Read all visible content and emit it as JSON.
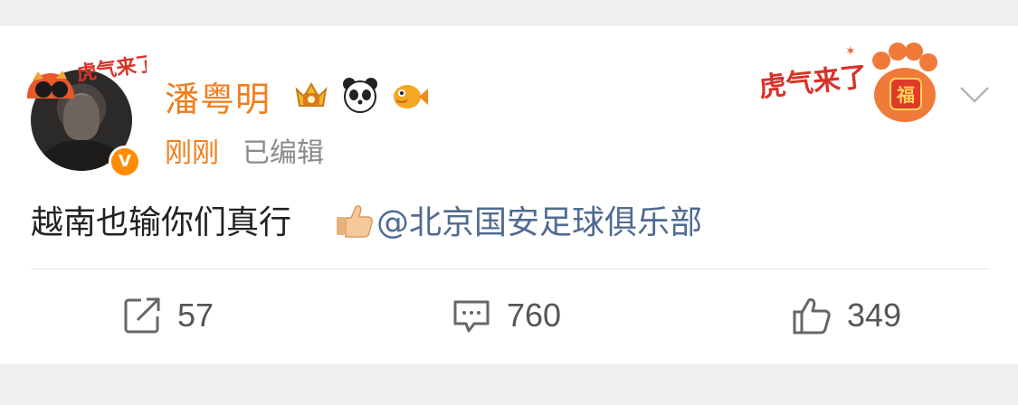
{
  "post": {
    "user": {
      "name": "潘粤明",
      "verified_mark": "V",
      "avatar_frame_text": "虎气来了",
      "badges": [
        "crown-badge",
        "panda-badge",
        "fish-badge"
      ]
    },
    "time": "刚刚",
    "edited_label": "已编辑",
    "banner": {
      "text": "虎气来了",
      "paw_text": "福"
    },
    "text": "越南也输你们真行",
    "emoji": "thumbs-up-icon",
    "mention": "@北京国安足球俱乐部"
  },
  "actions": {
    "share": {
      "icon": "share-icon",
      "count": "57"
    },
    "comment": {
      "icon": "comment-icon",
      "count": "760"
    },
    "like": {
      "icon": "thumbs-up-icon",
      "count": "349"
    }
  },
  "colors": {
    "accent": "#f07e1d",
    "mention": "#4f6b92",
    "verified": "#ff8c00",
    "background": "#efefef",
    "card": "#ffffff"
  }
}
